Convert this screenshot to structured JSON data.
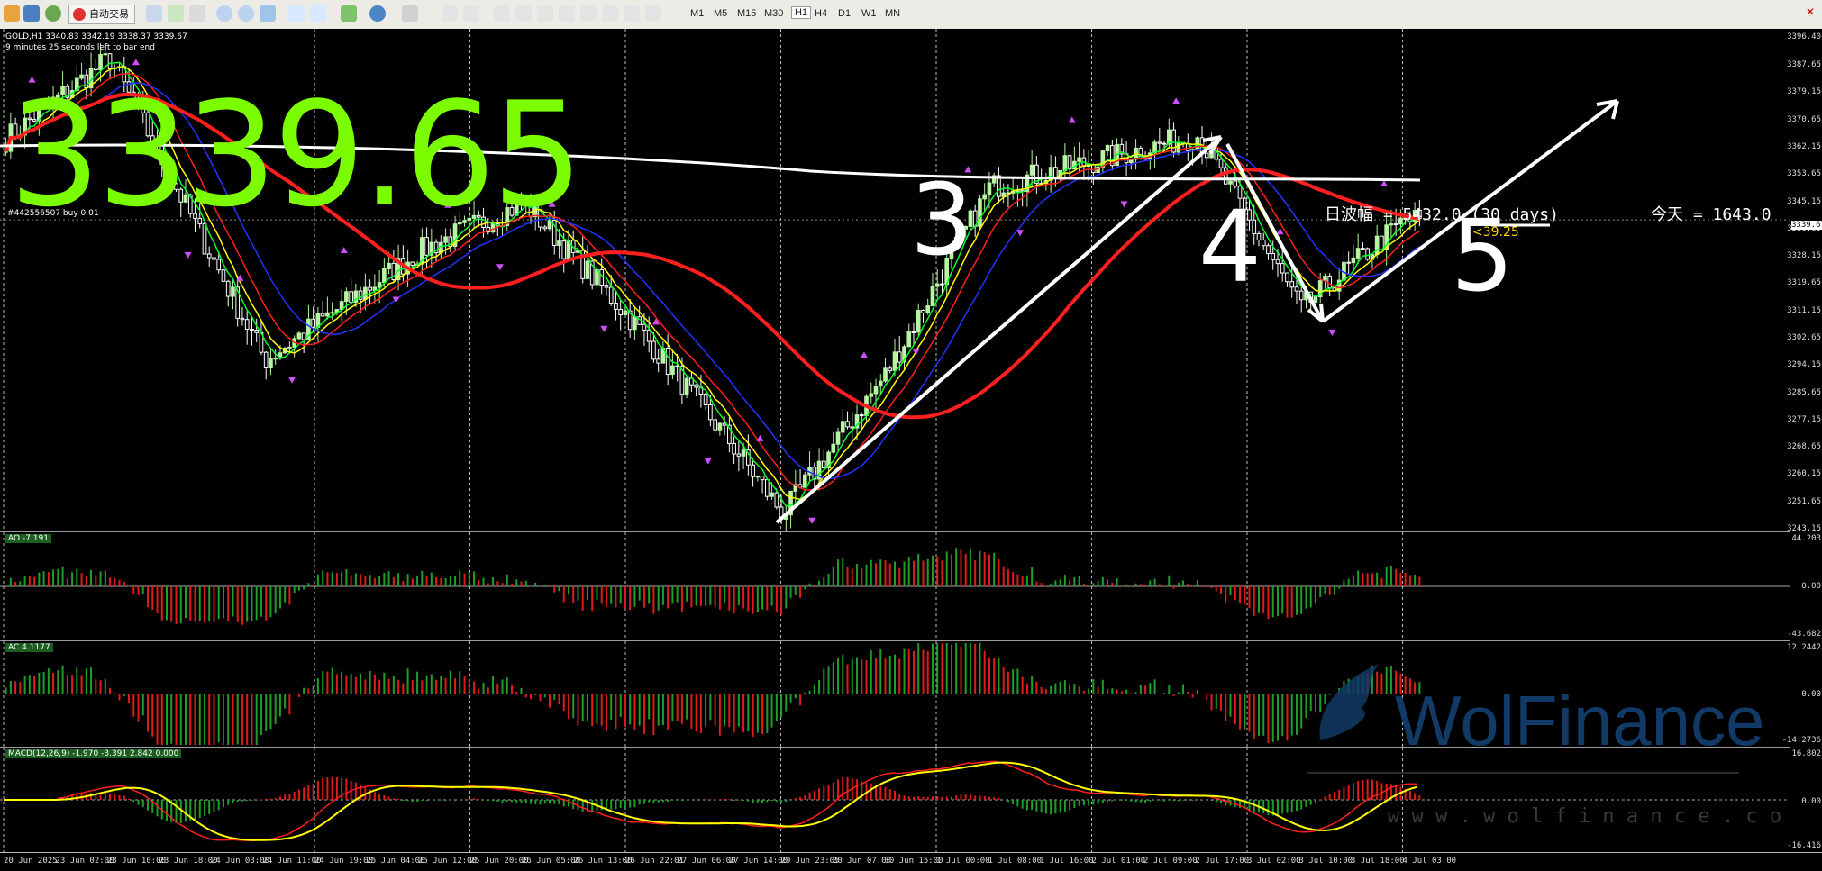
{
  "toolbar": {
    "auto_trading_label": "自动交易",
    "timeframes": [
      "M1",
      "M5",
      "M15",
      "M30",
      "H1",
      "H4",
      "D1",
      "W1",
      "MN"
    ],
    "active_timeframe": "H1"
  },
  "main_pane": {
    "symbol_line": "GOLD,H1  3340.83 3342.19 3338.37 3339.67",
    "countdown": "9 minutes 25 seconds left to bar end",
    "order_label": "#442556507 buy 0.01",
    "big_price": "3339.65",
    "daily_range_text": "日波幅 = 5432.0  (30 days)",
    "today_text": "今天 = 1643.0",
    "marker_text": "<39.25",
    "price_axis": [
      "3396.40",
      "3387.65",
      "3379.15",
      "3370.65",
      "3362.15",
      "3353.65",
      "3345.15",
      "3336.65",
      "3328.15",
      "3319.65",
      "3311.15",
      "3302.65",
      "3294.15",
      "3285.65",
      "3277.15",
      "3268.65",
      "3260.15",
      "3251.65",
      "3243.15"
    ],
    "current_price_tag": "3339.67",
    "handwritten_numbers": [
      "3",
      "4",
      "5"
    ]
  },
  "ao_pane": {
    "label": "AO -7.191",
    "axis": [
      "44.203",
      "0.00",
      "-43.682"
    ]
  },
  "ac_pane": {
    "label": "AC 4.1177",
    "axis": [
      "12.2442",
      "0.00",
      "-14.2736"
    ]
  },
  "macd_pane": {
    "label": "MACD(12,26,9) -1.970 -3.391 2.842 0.000",
    "axis": [
      "16.802",
      "0.00",
      "-16.416"
    ]
  },
  "watermark": {
    "brand": "WolFinance",
    "site": "w w w . w o l f i n a n c e . c o m"
  },
  "time_axis": [
    "20 Jun 2025",
    "23 Jun 02:00",
    "23 Jun 10:00",
    "23 Jun 18:00",
    "24 Jun 03:00",
    "24 Jun 11:00",
    "24 Jun 19:00",
    "25 Jun 04:00",
    "25 Jun 12:00",
    "25 Jun 20:00",
    "26 Jun 05:00",
    "26 Jun 13:00",
    "26 Jun 22:01",
    "27 Jun 06:00",
    "27 Jun 14:00",
    "29 Jun 23:05",
    "30 Jun 07:00",
    "30 Jun 15:00",
    "1 Jul 00:00",
    "1 Jul 08:00",
    "1 Jul 16:00",
    "2 Jul 01:00",
    "2 Jul 09:00",
    "2 Jul 17:00",
    "3 Jul 02:00",
    "3 Jul 10:00",
    "3 Jul 18:00",
    "4 Jul 03:00"
  ],
  "colors": {
    "bull": "#b6f5a1",
    "bear": "#ffffff",
    "ma_red": "#ff1f1f",
    "ma_blue": "#2233ff",
    "ma_yellow": "#ffff00",
    "ma_green": "#00ff2a",
    "hist_green": "#1e9e2a",
    "hist_red": "#e01b1b",
    "big_price": "#7cfc00"
  },
  "chart_data": {
    "type": "candlestick",
    "symbol": "GOLD",
    "timeframe": "H1",
    "ylim": [
      3243.15,
      3396.4
    ],
    "key_points": [
      {
        "x": "20 Jun 2025",
        "y": 3365
      },
      {
        "x": "23 Jun 10:00",
        "y": 3390
      },
      {
        "x": "24 Jun 11:00",
        "y": 3296
      },
      {
        "x": "25 Jun 12:00",
        "y": 3330
      },
      {
        "x": "26 Jun 05:00",
        "y": 3345
      },
      {
        "x": "26 Jun 22:01",
        "y": 3310
      },
      {
        "x": "27 Jun 14:00",
        "y": 3270
      },
      {
        "x": "29 Jun 23:05",
        "y": 3248
      },
      {
        "x": "30 Jun 15:00",
        "y": 3292
      },
      {
        "x": "1 Jul 08:00",
        "y": 3350
      },
      {
        "x": "2 Jul 17:00",
        "y": 3366
      },
      {
        "x": "3 Jul 10:00",
        "y": 3312
      },
      {
        "x": "4 Jul 03:00",
        "y": 3339.67
      }
    ]
  }
}
